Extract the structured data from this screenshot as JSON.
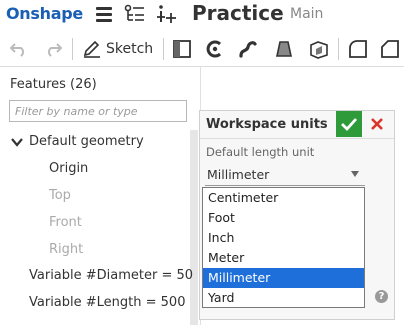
{
  "app": {
    "logo_text": "Onshape",
    "document_title": "Practice",
    "workspace_name": "Main",
    "accent_color": "#1a5fb4"
  },
  "toolbar": {
    "sketch_label": "Sketch",
    "icons": [
      "undo-icon",
      "redo-icon",
      "sketch-pencil-icon",
      "extrude-icon",
      "revolve-icon",
      "sweep-icon",
      "loft-icon",
      "thicken-icon",
      "fillet-icon",
      "chamfer-icon"
    ]
  },
  "features": {
    "title": "Features (26)",
    "filter_placeholder": "Filter by name or type",
    "default_geometry_label": "Default geometry",
    "items": [
      {
        "label": "Origin",
        "state": "normal"
      },
      {
        "label": "Top",
        "state": "hidden"
      },
      {
        "label": "Front",
        "state": "hidden"
      },
      {
        "label": "Right",
        "state": "hidden"
      }
    ],
    "variables": [
      "Variable #Diameter = 50",
      "Variable #Length = 500"
    ]
  },
  "dialog": {
    "title": "Workspace units",
    "field_label": "Default length unit",
    "selected_value": "Millimeter",
    "options": [
      "Centimeter",
      "Foot",
      "Inch",
      "Meter",
      "Millimeter",
      "Yard"
    ],
    "highlighted_option": "Millimeter",
    "ok_color": "#2e9a3a",
    "cancel_color": "#d9372b",
    "selection_color": "#1e6fd9",
    "help_glyph": "?"
  }
}
